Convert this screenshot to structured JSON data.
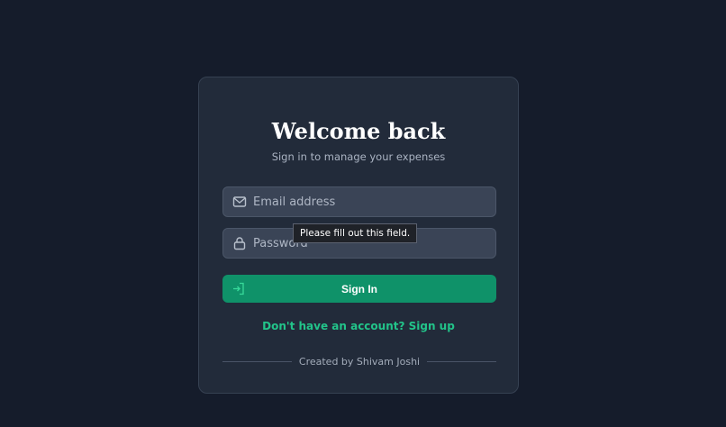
{
  "login": {
    "title": "Welcome back",
    "subtitle": "Sign in to manage your expenses",
    "email": {
      "placeholder": "Email address",
      "icon": "mail-icon"
    },
    "password": {
      "placeholder": "Password",
      "icon": "lock-icon"
    },
    "tooltip": "Please fill out this field.",
    "signin_label": "Sign In",
    "signin_icon": "log-in-icon",
    "signup_link": "Don't have an account? Sign up",
    "footer": "Created by Shivam Joshi"
  },
  "colors": {
    "background": "#151c2b",
    "card": "#222b3a",
    "primary": "#0f9269",
    "link": "#22c48a"
  }
}
